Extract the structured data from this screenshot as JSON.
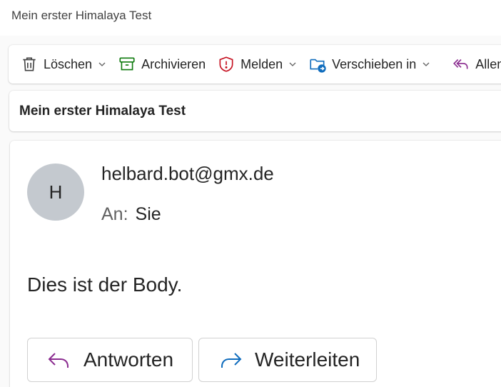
{
  "window": {
    "title": "Mein erster Himalaya Test"
  },
  "toolbar": {
    "delete_label": "Löschen",
    "archive_label": "Archivieren",
    "report_label": "Melden",
    "move_label": "Verschieben in",
    "reply_all_label": "Allen antworten"
  },
  "subject": "Mein erster Himalaya Test",
  "message": {
    "avatar_initial": "H",
    "sender": "helbard.bot@gmx.de",
    "to_label": "An:",
    "to_name": "Sie",
    "body": "Dies ist der Body."
  },
  "actions": {
    "reply_label": "Antworten",
    "forward_label": "Weiterleiten"
  },
  "colors": {
    "report_icon": "#c50f1f",
    "archive_icon": "#0e7a0d",
    "move_icon": "#0f6cbd",
    "reply_icon": "#8a2b8f",
    "forward_icon": "#0f6cbd"
  },
  "icons": {
    "delete": "trash-icon",
    "archive": "archive-box-icon",
    "report": "shield-alert-icon",
    "move": "folder-move-icon",
    "reply_all": "reply-all-icon",
    "reply": "reply-arrow-icon",
    "forward": "forward-arrow-icon"
  }
}
